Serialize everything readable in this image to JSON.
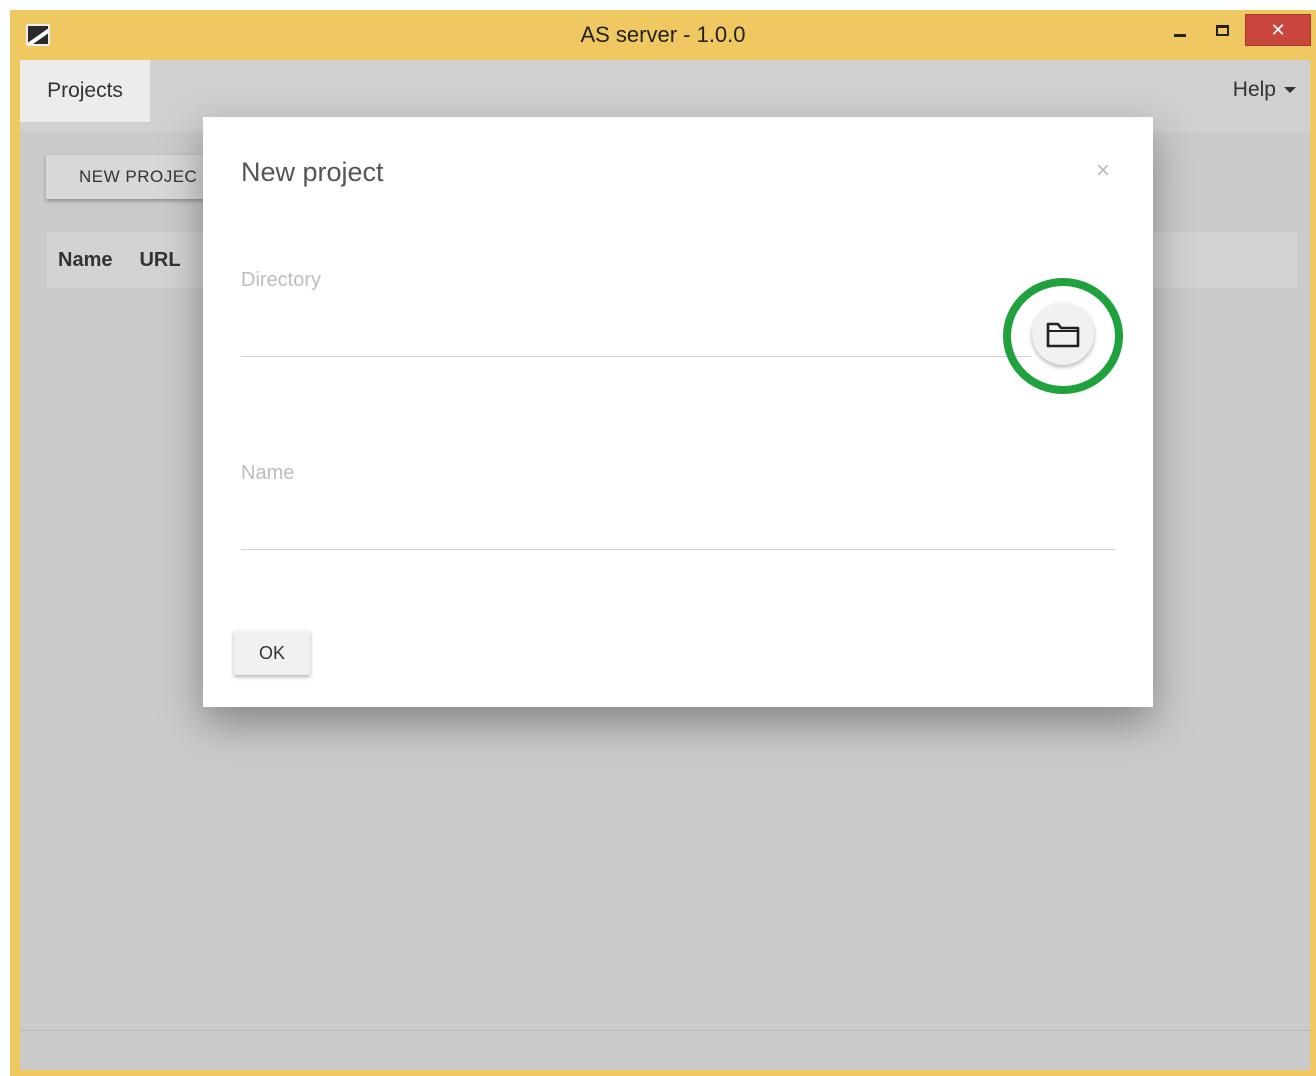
{
  "window": {
    "title": "AS server - 1.0.0",
    "controls": {
      "minimize": "minimize",
      "maximize": "maximize",
      "close": "✕"
    }
  },
  "menubar": {
    "projects": "Projects",
    "help": "Help"
  },
  "toolbar": {
    "new_project_label": "NEW PROJEC"
  },
  "table": {
    "columns": [
      "Name",
      "URL"
    ]
  },
  "dialog": {
    "title": "New project",
    "close_symbol": "×",
    "directory": {
      "label": "Directory",
      "value": ""
    },
    "name": {
      "label": "Name",
      "value": ""
    },
    "browse_icon": "folder-icon",
    "ok_label": "OK"
  },
  "colors": {
    "titlebar": "#f0c862",
    "close_button": "#c9463d",
    "highlight": "#1fa13e",
    "backdrop": "#cbcbcb"
  }
}
